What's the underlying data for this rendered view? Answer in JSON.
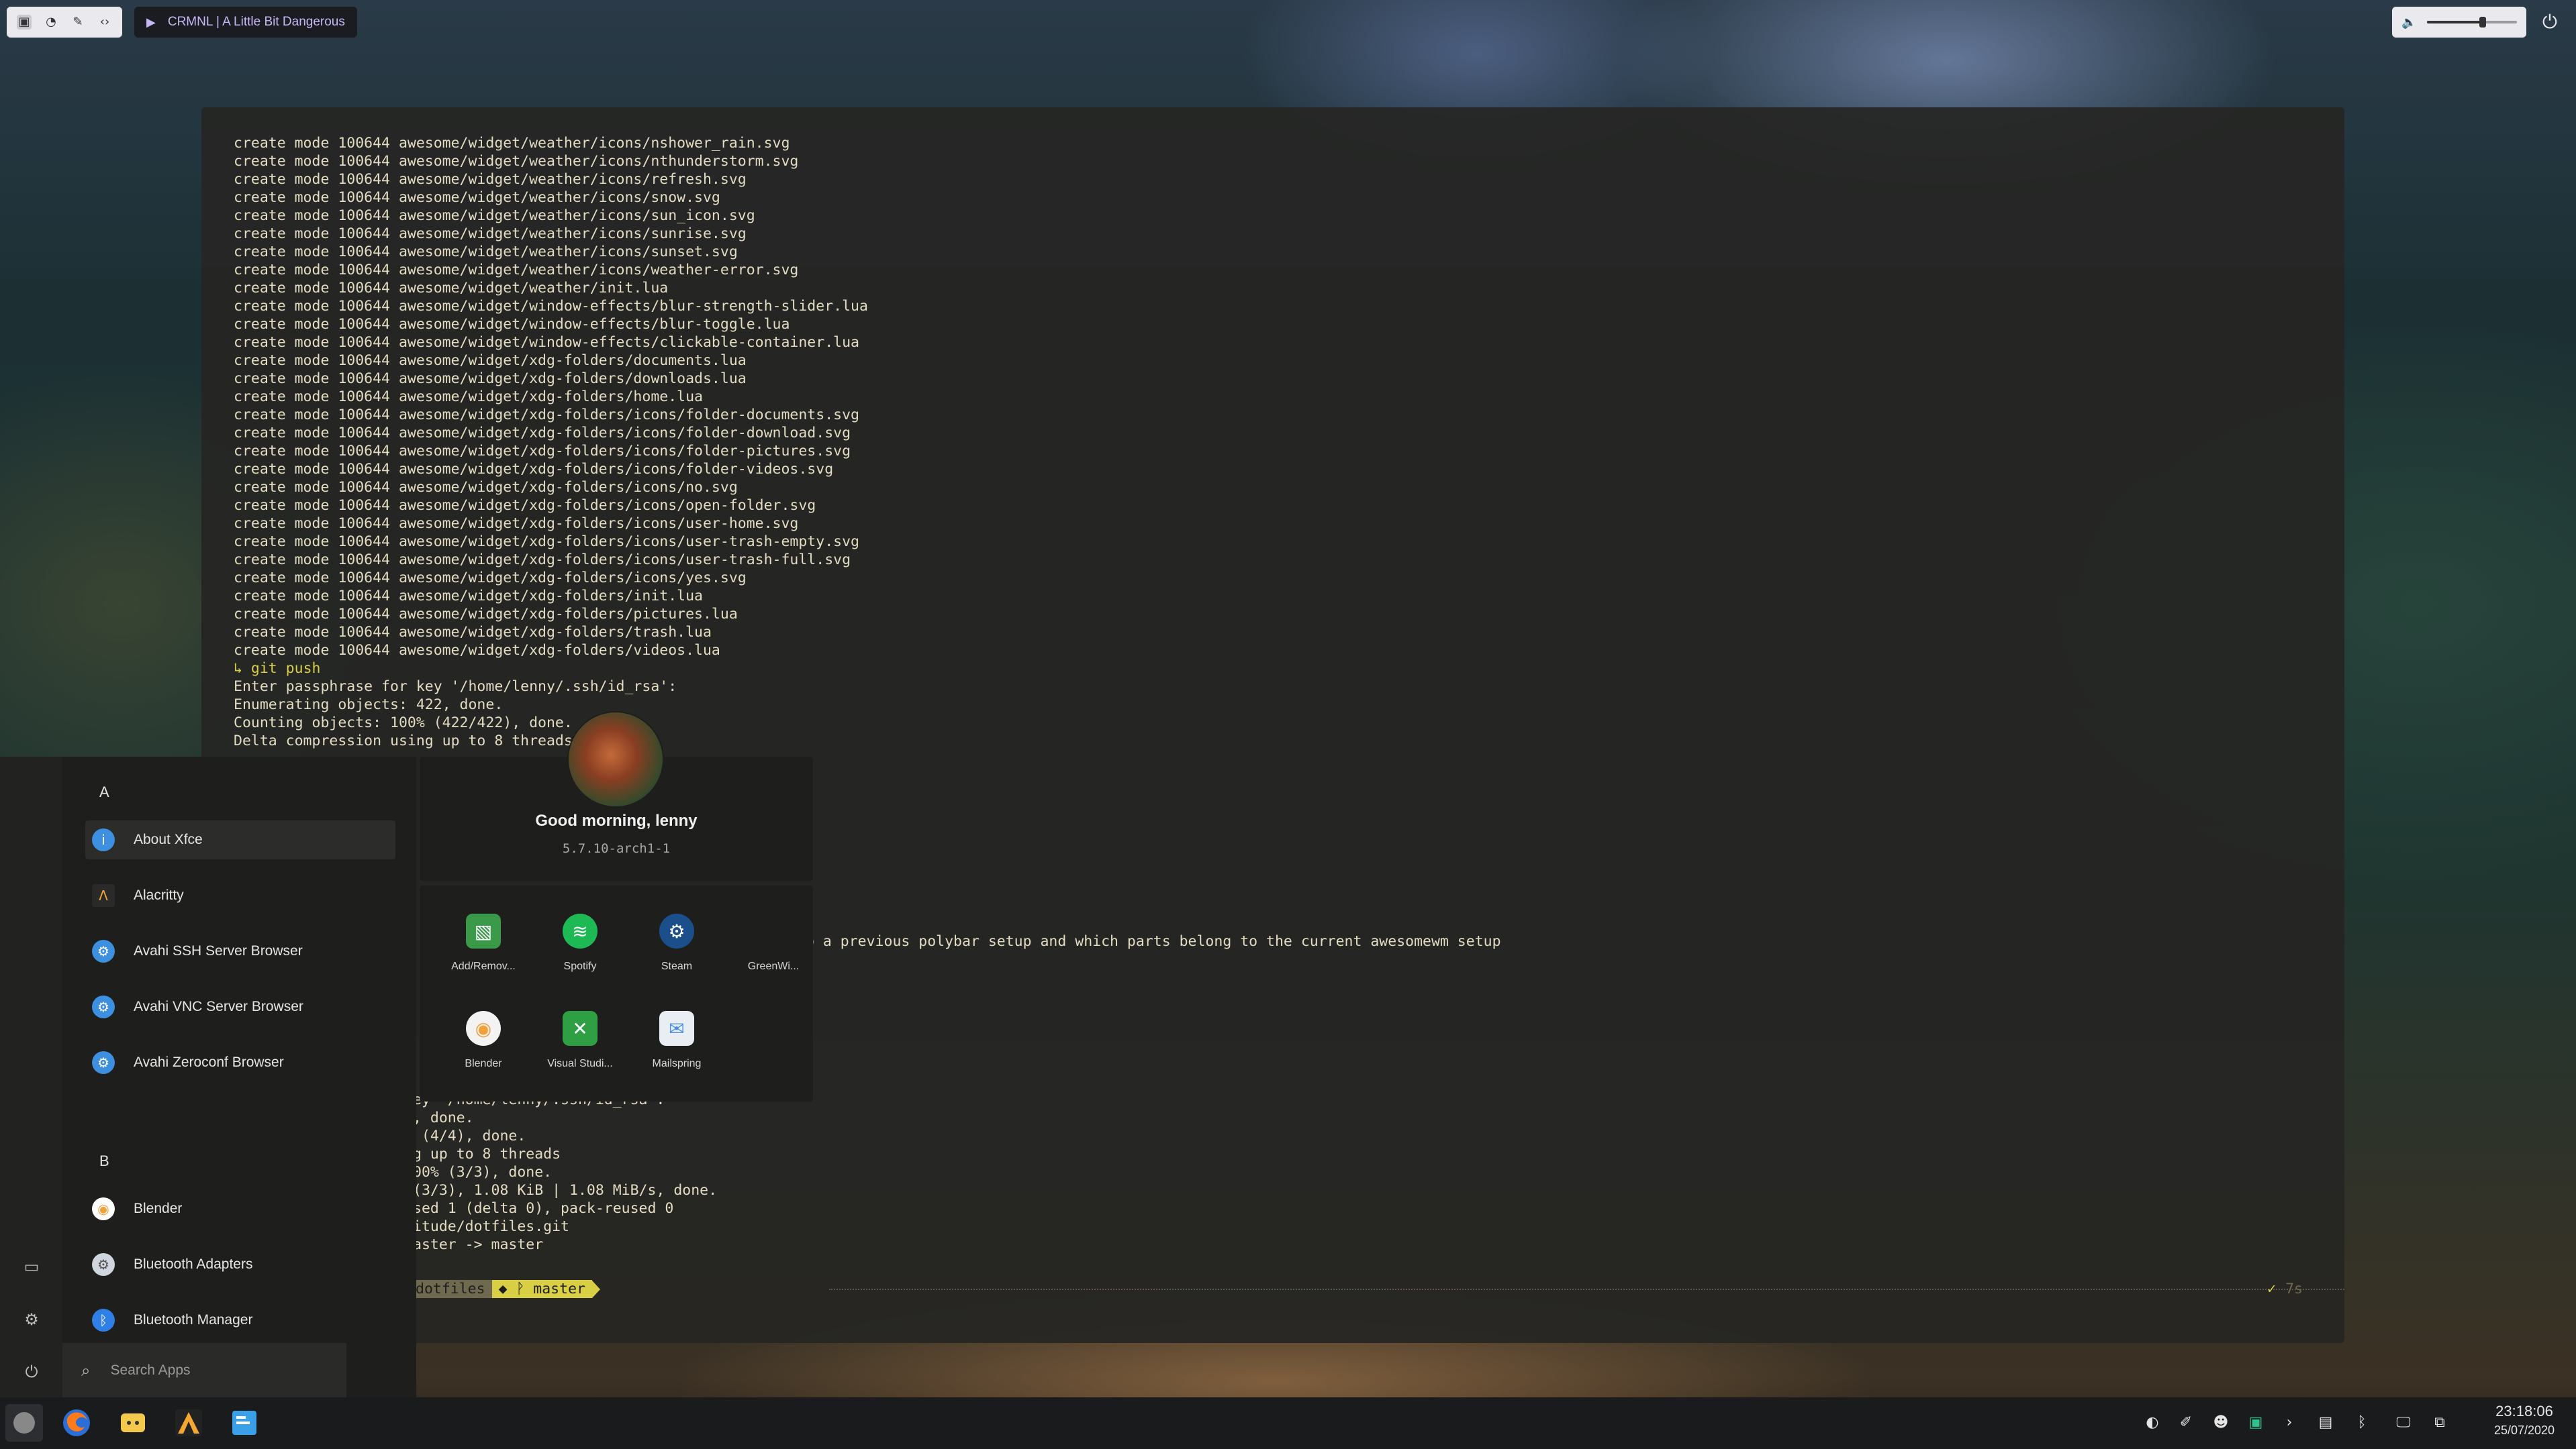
{
  "topbar": {
    "media_title": "CRMNL | A Little Bit Dangerous",
    "volume_percent": 62
  },
  "terminal": {
    "lines": [
      "create mode 100644 awesome/widget/weather/icons/nshower_rain.svg",
      "create mode 100644 awesome/widget/weather/icons/nthunderstorm.svg",
      "create mode 100644 awesome/widget/weather/icons/refresh.svg",
      "create mode 100644 awesome/widget/weather/icons/snow.svg",
      "create mode 100644 awesome/widget/weather/icons/sun_icon.svg",
      "create mode 100644 awesome/widget/weather/icons/sunrise.svg",
      "create mode 100644 awesome/widget/weather/icons/sunset.svg",
      "create mode 100644 awesome/widget/weather/icons/weather-error.svg",
      "create mode 100644 awesome/widget/weather/init.lua",
      "create mode 100644 awesome/widget/window-effects/blur-strength-slider.lua",
      "create mode 100644 awesome/widget/window-effects/blur-toggle.lua",
      "create mode 100644 awesome/widget/window-effects/clickable-container.lua",
      "create mode 100644 awesome/widget/xdg-folders/documents.lua",
      "create mode 100644 awesome/widget/xdg-folders/downloads.lua",
      "create mode 100644 awesome/widget/xdg-folders/home.lua",
      "create mode 100644 awesome/widget/xdg-folders/icons/folder-documents.svg",
      "create mode 100644 awesome/widget/xdg-folders/icons/folder-download.svg",
      "create mode 100644 awesome/widget/xdg-folders/icons/folder-pictures.svg",
      "create mode 100644 awesome/widget/xdg-folders/icons/folder-videos.svg",
      "create mode 100644 awesome/widget/xdg-folders/icons/no.svg",
      "create mode 100644 awesome/widget/xdg-folders/icons/open-folder.svg",
      "create mode 100644 awesome/widget/xdg-folders/icons/user-home.svg",
      "create mode 100644 awesome/widget/xdg-folders/icons/user-trash-empty.svg",
      "create mode 100644 awesome/widget/xdg-folders/icons/user-trash-full.svg",
      "create mode 100644 awesome/widget/xdg-folders/icons/yes.svg",
      "create mode 100644 awesome/widget/xdg-folders/init.lua",
      "create mode 100644 awesome/widget/xdg-folders/pictures.lua",
      "create mode 100644 awesome/widget/xdg-folders/trash.lua",
      "create mode 100644 awesome/widget/xdg-folders/videos.lua"
    ],
    "git_push_cmd": "git push",
    "push_lines": [
      "Enter passphrase for key '/home/lenny/.ssh/id_rsa':",
      "Enumerating objects: 422, done.",
      "Counting objects: 100% (422/422), done.",
      "Delta compression using up to 8 threads"
    ],
    "middle_partial": "o a previous polybar setup and which parts belong to the current awesomewm setup",
    "tail_lines": [
      "ey '/home/lenny/.ssh/id_rsa':",
      ", done.",
      " (4/4), done.",
      "g up to 8 threads",
      "00% (3/3), done.",
      "(3/3), 1.08 KiB | 1.08 MiB/s, done.",
      "sed 1 (delta 0), pack-reused 0",
      "itude/dotfiles.git",
      "aster -> master"
    ],
    "prompt_dir": "dotfiles",
    "prompt_branch": "master",
    "prompt_time": "7s"
  },
  "startmenu": {
    "sections": [
      {
        "letter": "A",
        "items": [
          {
            "label": "About Xfce",
            "icon": "info-icon",
            "color": "#3d8fe0"
          },
          {
            "label": "Alacritty",
            "icon": "alacritty-icon",
            "color": "#2a2a2a"
          },
          {
            "label": "Avahi SSH Server Browser",
            "icon": "avahi-icon",
            "color": "#3d8fe0"
          },
          {
            "label": "Avahi VNC Server Browser",
            "icon": "avahi-icon",
            "color": "#3d8fe0"
          },
          {
            "label": "Avahi Zeroconf Browser",
            "icon": "avahi-icon",
            "color": "#3d8fe0"
          }
        ]
      },
      {
        "letter": "B",
        "items": [
          {
            "label": "Blender",
            "icon": "blender-icon",
            "color": "#ffffff"
          },
          {
            "label": "Bluetooth Adapters",
            "icon": "bluetooth-settings-icon",
            "color": "#cfd6de"
          },
          {
            "label": "Bluetooth Manager",
            "icon": "bluetooth-icon",
            "color": "#2f7fe6"
          }
        ]
      }
    ],
    "search_placeholder": "Search Apps"
  },
  "profile": {
    "greeting": "Good morning, lenny",
    "kernel": "5.7.10-arch1-1"
  },
  "apps": [
    {
      "label": "Add/Remov...",
      "icon": "package-icon",
      "color": "#3a9a4a"
    },
    {
      "label": "Spotify",
      "icon": "spotify-icon",
      "color": "#1db954"
    },
    {
      "label": "Steam",
      "icon": "steam-icon",
      "color": "#1b4f8c"
    },
    {
      "label": "GreenWi...",
      "icon": "greenwithenvy-icon",
      "color": "#1e1e1d"
    },
    {
      "label": "Blender",
      "icon": "blender-icon",
      "color": "#f3f3f3"
    },
    {
      "label": "Visual Studi...",
      "icon": "vscode-icon",
      "color": "#2ea043"
    },
    {
      "label": "Mailspring",
      "icon": "mail-icon",
      "color": "#e9eef4"
    }
  ],
  "taskbar": {
    "time": "23:18:06",
    "date": "25/07/2020"
  }
}
